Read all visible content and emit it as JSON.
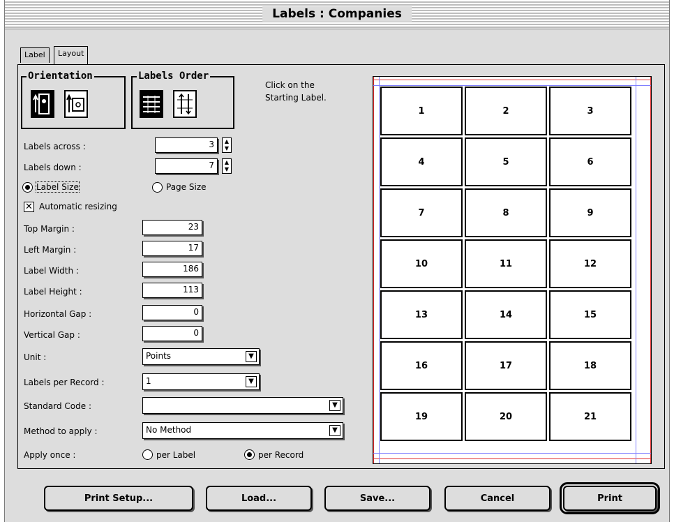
{
  "window": {
    "title": "Labels : Companies"
  },
  "tabs": [
    {
      "label": "Label"
    },
    {
      "label": "Layout"
    }
  ],
  "orientation": {
    "legend": "Orientation"
  },
  "labels_order": {
    "legend": "Labels Order"
  },
  "hint": {
    "line1": "Click on the",
    "line2": "Starting Label."
  },
  "labels_across": {
    "label": "Labels across :",
    "value": "3"
  },
  "labels_down": {
    "label": "Labels down :",
    "value": "7"
  },
  "size_mode": {
    "label_size": "Label Size",
    "page_size": "Page Size",
    "selected": "label_size"
  },
  "auto_resize": {
    "label": "Automatic resizing",
    "checked": true
  },
  "margins": {
    "top": {
      "label": "Top Margin :",
      "value": "23"
    },
    "left": {
      "label": "Left Margin :",
      "value": "17"
    },
    "width": {
      "label": "Label Width :",
      "value": "186"
    },
    "height": {
      "label": "Label Height :",
      "value": "113"
    },
    "hgap": {
      "label": "Horizontal Gap :",
      "value": "0"
    },
    "vgap": {
      "label": "Vertical Gap :",
      "value": "0"
    }
  },
  "unit": {
    "label": "Unit :",
    "value": "Points"
  },
  "labels_per_record": {
    "label": "Labels per Record :",
    "value": "1"
  },
  "standard_code": {
    "label": "Standard Code :",
    "value": ""
  },
  "method": {
    "label": "Method to apply :",
    "value": "No Method"
  },
  "apply_once": {
    "label": "Apply once :",
    "per_label": "per Label",
    "per_record": "per Record",
    "selected": "per_record"
  },
  "preview": {
    "cells": [
      "1",
      "2",
      "3",
      "4",
      "5",
      "6",
      "7",
      "8",
      "9",
      "10",
      "11",
      "12",
      "13",
      "14",
      "15",
      "16",
      "17",
      "18",
      "19",
      "20",
      "21"
    ],
    "margin_color": "#e03030",
    "guide_color": "#8080ff"
  },
  "buttons": {
    "print_setup": "Print Setup...",
    "load": "Load...",
    "save": "Save...",
    "cancel": "Cancel",
    "print": "Print"
  }
}
